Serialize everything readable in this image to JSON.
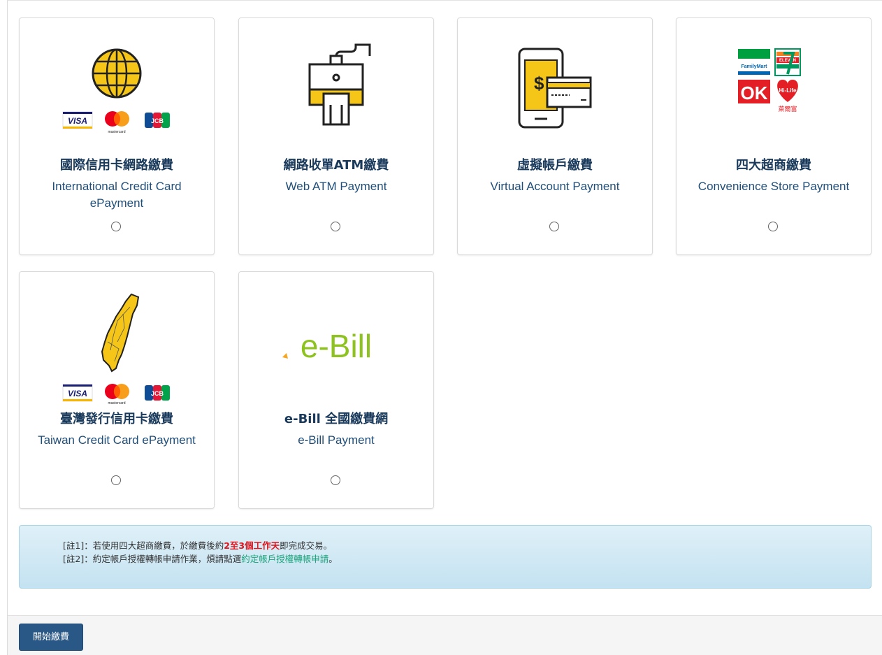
{
  "payment_methods": [
    {
      "title_zh": "國際信用卡網路繳費",
      "title_en": "International Credit Card ePayment",
      "logo": "globe-icon"
    },
    {
      "title_zh": "網路收單ATM繳費",
      "title_en": "Web ATM Payment",
      "logo": "card-reader-icon"
    },
    {
      "title_zh": "虛擬帳戶繳費",
      "title_en": "Virtual Account Payment",
      "logo": "phone-card-icon"
    },
    {
      "title_zh": "四大超商繳費",
      "title_en": "Convenience Store Payment",
      "logo": "convenience-stores-icon"
    },
    {
      "title_zh": "臺灣發行信用卡繳費",
      "title_en": "Taiwan Credit Card ePayment",
      "logo": "taiwan-map-icon"
    },
    {
      "title_zh": "e-Bill 全國繳費網",
      "title_en": "e-Bill Payment",
      "logo": "ebill-logo"
    }
  ],
  "logos": {
    "visa": "VISA",
    "mastercard": "mastercard",
    "jcb": "JCB",
    "ebill": "e-Bill",
    "familymart": "FamilyMart",
    "eleven": "ELEVEN",
    "ok": "OK",
    "hilife": "Hi-Life",
    "hilife_zh": "萊爾富"
  },
  "notes": {
    "note1_prefix": "[註1]：若使用四大超商繳費，於繳費後約",
    "note1_highlight": "2至3個工作天",
    "note1_suffix": "即完成交易。",
    "note2_prefix": "[註2]：約定帳戶授權轉帳申請作業，煩請點選",
    "note2_link": "約定帳戶授權轉帳申請",
    "note2_suffix": "。"
  },
  "submit_label": "開始繳費",
  "colors": {
    "title": "#1a3a5c",
    "subtitle": "#1f4e79",
    "button": "#2a5886",
    "highlight": "#e0121a",
    "link": "#1aa37a"
  }
}
